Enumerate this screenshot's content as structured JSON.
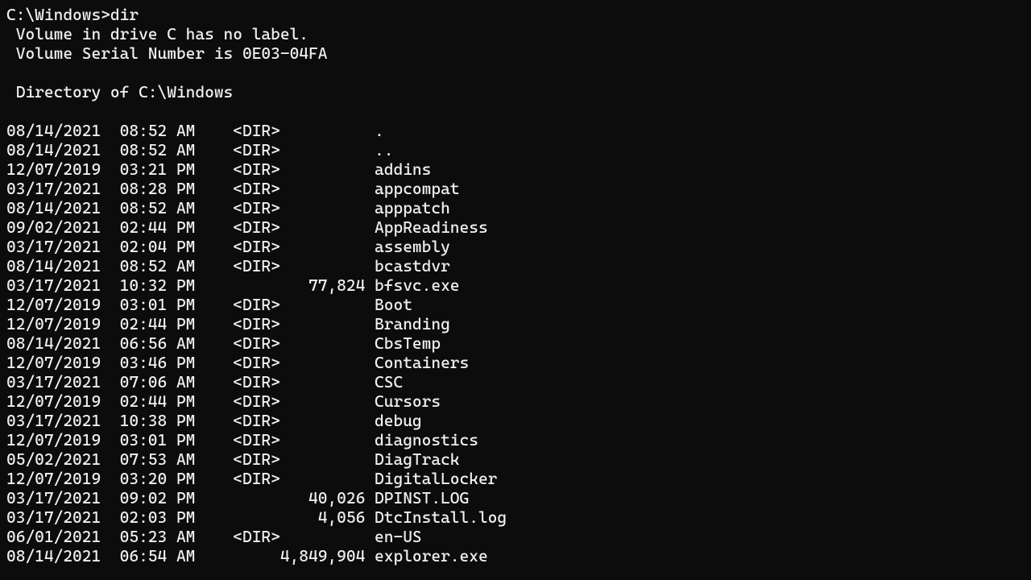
{
  "prompt": "C:\\Windows>dir",
  "volume_line": " Volume in drive C has no label.",
  "serial_line": " Volume Serial Number is 0E03-04FA",
  "blank": "",
  "directory_of": " Directory of C:\\Windows",
  "entries": [
    {
      "date": "08/14/2021",
      "time": "08:52 AM",
      "dir": true,
      "size": "",
      "name": "."
    },
    {
      "date": "08/14/2021",
      "time": "08:52 AM",
      "dir": true,
      "size": "",
      "name": ".."
    },
    {
      "date": "12/07/2019",
      "time": "03:21 PM",
      "dir": true,
      "size": "",
      "name": "addins"
    },
    {
      "date": "03/17/2021",
      "time": "08:28 PM",
      "dir": true,
      "size": "",
      "name": "appcompat"
    },
    {
      "date": "08/14/2021",
      "time": "08:52 AM",
      "dir": true,
      "size": "",
      "name": "apppatch"
    },
    {
      "date": "09/02/2021",
      "time": "02:44 PM",
      "dir": true,
      "size": "",
      "name": "AppReadiness"
    },
    {
      "date": "03/17/2021",
      "time": "02:04 PM",
      "dir": true,
      "size": "",
      "name": "assembly"
    },
    {
      "date": "08/14/2021",
      "time": "08:52 AM",
      "dir": true,
      "size": "",
      "name": "bcastdvr"
    },
    {
      "date": "03/17/2021",
      "time": "10:32 PM",
      "dir": false,
      "size": "77,824",
      "name": "bfsvc.exe"
    },
    {
      "date": "12/07/2019",
      "time": "03:01 PM",
      "dir": true,
      "size": "",
      "name": "Boot"
    },
    {
      "date": "12/07/2019",
      "time": "02:44 PM",
      "dir": true,
      "size": "",
      "name": "Branding"
    },
    {
      "date": "08/14/2021",
      "time": "06:56 AM",
      "dir": true,
      "size": "",
      "name": "CbsTemp"
    },
    {
      "date": "12/07/2019",
      "time": "03:46 PM",
      "dir": true,
      "size": "",
      "name": "Containers"
    },
    {
      "date": "03/17/2021",
      "time": "07:06 AM",
      "dir": true,
      "size": "",
      "name": "CSC"
    },
    {
      "date": "12/07/2019",
      "time": "02:44 PM",
      "dir": true,
      "size": "",
      "name": "Cursors"
    },
    {
      "date": "03/17/2021",
      "time": "10:38 PM",
      "dir": true,
      "size": "",
      "name": "debug"
    },
    {
      "date": "12/07/2019",
      "time": "03:01 PM",
      "dir": true,
      "size": "",
      "name": "diagnostics"
    },
    {
      "date": "05/02/2021",
      "time": "07:53 AM",
      "dir": true,
      "size": "",
      "name": "DiagTrack"
    },
    {
      "date": "12/07/2019",
      "time": "03:20 PM",
      "dir": true,
      "size": "",
      "name": "DigitalLocker"
    },
    {
      "date": "03/17/2021",
      "time": "09:02 PM",
      "dir": false,
      "size": "40,026",
      "name": "DPINST.LOG"
    },
    {
      "date": "03/17/2021",
      "time": "02:03 PM",
      "dir": false,
      "size": "4,056",
      "name": "DtcInstall.log"
    },
    {
      "date": "06/01/2021",
      "time": "05:23 AM",
      "dir": true,
      "size": "",
      "name": "en-US"
    },
    {
      "date": "08/14/2021",
      "time": "06:54 AM",
      "dir": false,
      "size": "4,849,904",
      "name": "explorer.exe"
    }
  ]
}
